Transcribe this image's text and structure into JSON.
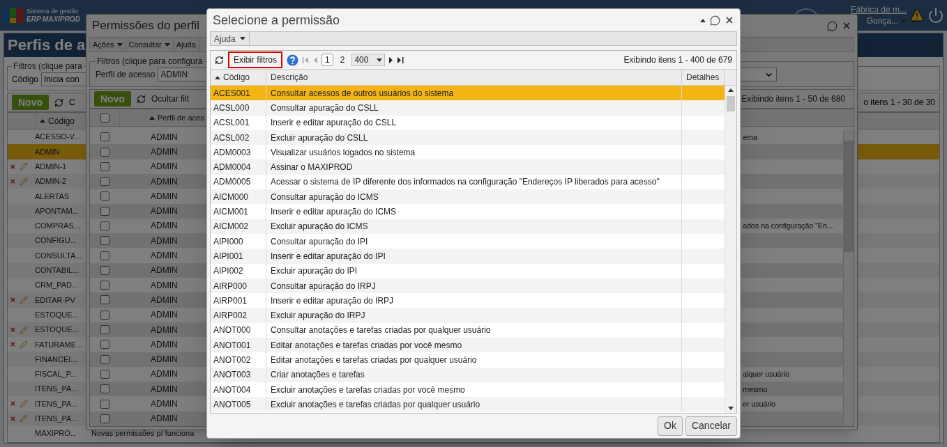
{
  "app": {
    "brand_line1": "Sistema de gestão",
    "brand_line2": "ERP MAXIPROD",
    "company": "Fábrica de m...",
    "user": "Gonça..."
  },
  "page": {
    "title": "Perfis de a",
    "filters_legend": "Filtros (clique para",
    "filter_label": "Código",
    "filter_value": "Inicia con",
    "new_button": "Novo",
    "toolbar_text": "C",
    "pager_text": "o itens 1 - 30 de 30",
    "column": "Código",
    "rows": [
      {
        "code": "ACESSO-V...",
        "selected": false,
        "editable": false
      },
      {
        "code": "ADMIN",
        "selected": true,
        "editable": false
      },
      {
        "code": "ADMIN-1",
        "selected": false,
        "editable": true
      },
      {
        "code": "ADMIN-2",
        "selected": false,
        "editable": true
      },
      {
        "code": "ALERTAS",
        "selected": false,
        "editable": false
      },
      {
        "code": "APONTAM...",
        "selected": false,
        "editable": false
      },
      {
        "code": "COMPRAS...",
        "selected": false,
        "editable": false
      },
      {
        "code": "CONFIGU...",
        "selected": false,
        "editable": false
      },
      {
        "code": "CONSULTA...",
        "selected": false,
        "editable": false
      },
      {
        "code": "CONTABIL...",
        "selected": false,
        "editable": false
      },
      {
        "code": "CRM_PAD...",
        "selected": false,
        "editable": false
      },
      {
        "code": "EDITAR-PV",
        "selected": false,
        "editable": true
      },
      {
        "code": "ESTOQUE...",
        "selected": false,
        "editable": false
      },
      {
        "code": "ESTOQUE...",
        "selected": false,
        "editable": true
      },
      {
        "code": "FATURAME...",
        "selected": false,
        "editable": true
      },
      {
        "code": "FINANCEI...",
        "selected": false,
        "editable": false
      },
      {
        "code": "FISCAL_P...",
        "selected": false,
        "editable": false
      },
      {
        "code": "ITENS_PA...",
        "selected": false,
        "editable": false
      },
      {
        "code": "ITENS_PA...",
        "selected": false,
        "editable": true
      },
      {
        "code": "ITENS_PA...",
        "selected": false,
        "editable": true
      },
      {
        "code": "MAXIPRO...",
        "selected": false,
        "editable": false,
        "description": "Novas permissões p/ funciona"
      }
    ]
  },
  "permissions_window": {
    "title": "Permissões do perfil",
    "menu": [
      "Ações",
      "Consultar",
      "Ajuda"
    ],
    "filters_legend": "Filtros (clique para configura",
    "filter_label": "Perfil de acesso",
    "filter_value": "ADMIN",
    "new_button": "Novo",
    "hide_filters": "Ocultar filt",
    "all_checked": false,
    "status": "Exibindo itens 1 - 50 de 680",
    "column": "Perfil de aces",
    "rows": [
      {
        "profile": "ADMIN",
        "checked": false,
        "description_tail": "ema"
      },
      {
        "profile": "ADMIN",
        "checked": false
      },
      {
        "profile": "ADMIN",
        "checked": false
      },
      {
        "profile": "ADMIN",
        "checked": false
      },
      {
        "profile": "ADMIN",
        "checked": false
      },
      {
        "profile": "ADMIN",
        "checked": false
      },
      {
        "profile": "ADMIN",
        "checked": false,
        "description_tail": "ados na configuração \"En..."
      },
      {
        "profile": "ADMIN",
        "checked": false
      },
      {
        "profile": "ADMIN",
        "checked": false
      },
      {
        "profile": "ADMIN",
        "checked": false
      },
      {
        "profile": "ADMIN",
        "checked": false
      },
      {
        "profile": "ADMIN",
        "checked": false
      },
      {
        "profile": "ADMIN",
        "checked": false
      },
      {
        "profile": "ADMIN",
        "checked": false
      },
      {
        "profile": "ADMIN",
        "checked": false
      },
      {
        "profile": "ADMIN",
        "checked": false
      },
      {
        "profile": "ADMIN",
        "checked": false,
        "description_tail": "alquer usuário"
      },
      {
        "profile": "ADMIN",
        "checked": false,
        "description_tail": "mesmo"
      },
      {
        "profile": "ADMIN",
        "checked": false,
        "description_tail": "er usuário"
      },
      {
        "profile": "ADMIN",
        "checked": false
      }
    ]
  },
  "dialog": {
    "title": "Selecione a permissão",
    "menu": [
      "Ajuda"
    ],
    "filters_button": {
      "label": "Exibir filtros",
      "highlighted": true
    },
    "pages": [
      {
        "label": "1",
        "selected": true
      },
      {
        "label": "2",
        "selected": false
      }
    ],
    "page_size": "400",
    "status": "Exibindo itens 1 - 400 de 679",
    "columns": [
      "Código",
      "Descrição",
      "Detalhes"
    ],
    "rows": [
      {
        "code": "ACES001",
        "description": "Consultar acessos de outros usuários do sistema",
        "selected": true
      },
      {
        "code": "ACSL000",
        "description": "Consultar apuração do CSLL",
        "selected": false
      },
      {
        "code": "ACSL001",
        "description": "Inserir e editar apuração do CSLL",
        "selected": false
      },
      {
        "code": "ACSL002",
        "description": "Excluir apuração do CSLL",
        "selected": false
      },
      {
        "code": "ADM0003",
        "description": "Visualizar usuários logados no sistema",
        "selected": false
      },
      {
        "code": "ADM0004",
        "description": "Assinar o MAXIPROD",
        "selected": false
      },
      {
        "code": "ADM0005",
        "description": "Acessar o sistema de IP diferente dos informados na configuração \"Endereços IP liberados para acesso\"",
        "selected": false
      },
      {
        "code": "AICM000",
        "description": "Consultar apuração do ICMS",
        "selected": false
      },
      {
        "code": "AICM001",
        "description": "Inserir e editar apuração do ICMS",
        "selected": false
      },
      {
        "code": "AICM002",
        "description": "Excluir apuração do ICMS",
        "selected": false
      },
      {
        "code": "AIPI000",
        "description": "Consultar apuração do IPI",
        "selected": false
      },
      {
        "code": "AIPI001",
        "description": "Inserir e editar apuração do IPI",
        "selected": false
      },
      {
        "code": "AIPI002",
        "description": "Excluir apuração do IPI",
        "selected": false
      },
      {
        "code": "AIRP000",
        "description": "Consultar apuração do IRPJ",
        "selected": false
      },
      {
        "code": "AIRP001",
        "description": "Inserir e editar apuração do IRPJ",
        "selected": false
      },
      {
        "code": "AIRP002",
        "description": "Excluir apuração do IRPJ",
        "selected": false
      },
      {
        "code": "ANOT000",
        "description": "Consultar anotações e tarefas criadas por qualquer usuário",
        "selected": false
      },
      {
        "code": "ANOT001",
        "description": "Editar anotações e tarefas criadas por você mesmo",
        "selected": false
      },
      {
        "code": "ANOT002",
        "description": "Editar anotações e tarefas criadas por qualquer usuário",
        "selected": false
      },
      {
        "code": "ANOT003",
        "description": "Criar anotações e tarefas",
        "selected": false
      },
      {
        "code": "ANOT004",
        "description": "Excluir anotações e tarefas criadas por você mesmo",
        "selected": false
      },
      {
        "code": "ANOT005",
        "description": "Excluir anotações e tarefas criadas por qualquer usuário",
        "selected": false
      }
    ],
    "buttons": [
      "Ok",
      "Cancelar"
    ]
  }
}
